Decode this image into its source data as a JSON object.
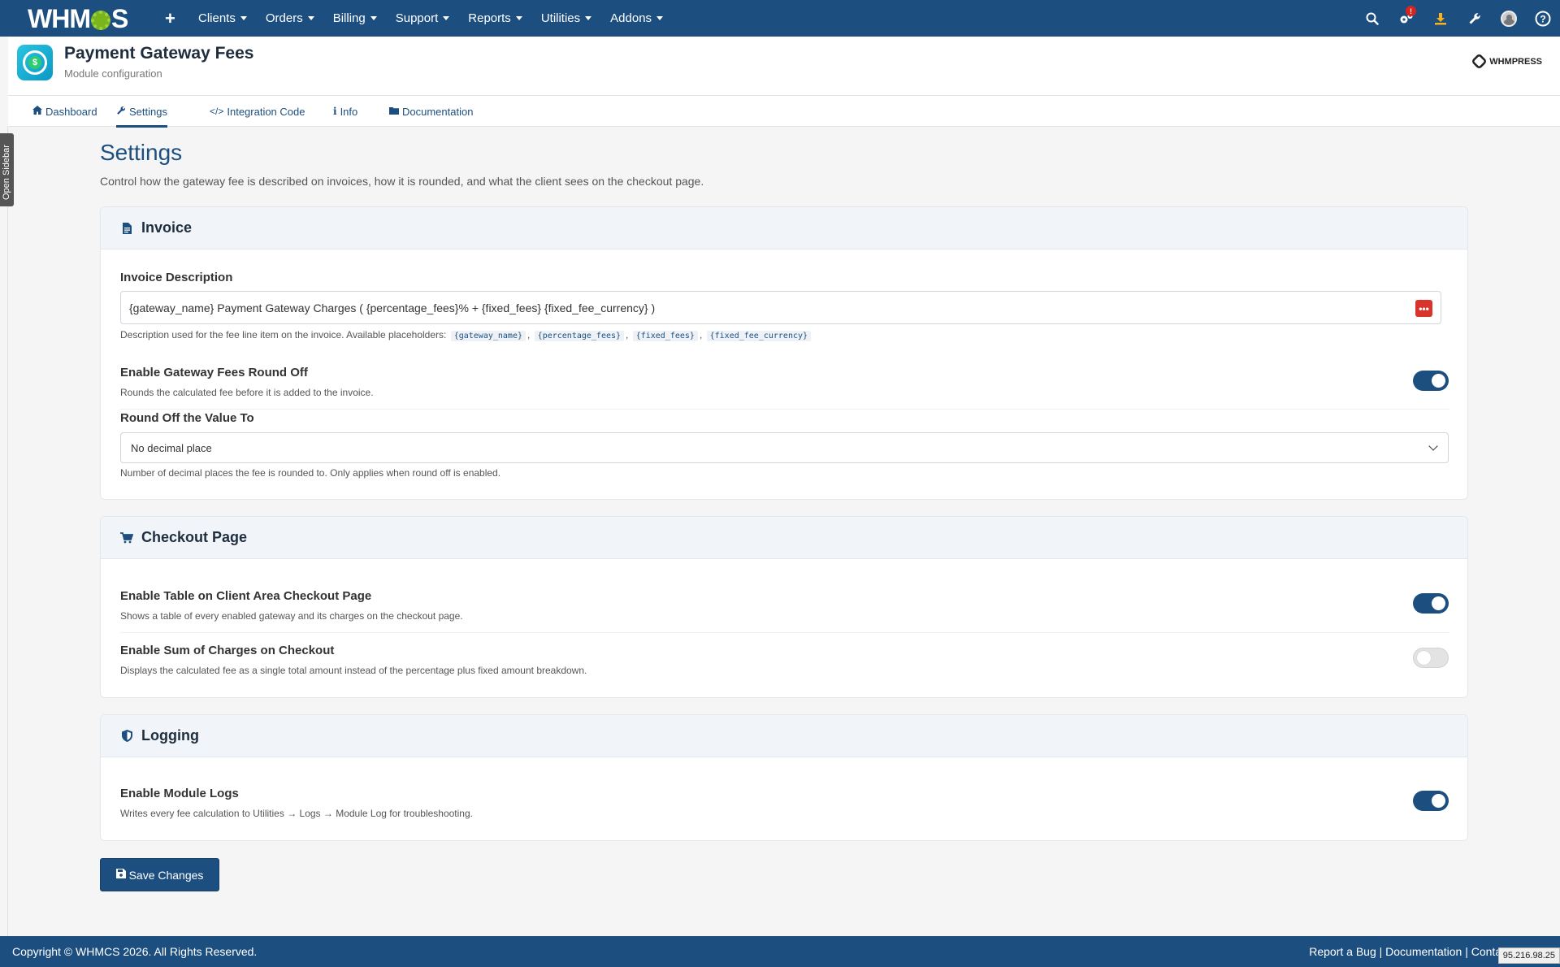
{
  "nav": {
    "logo": "WHMCS",
    "menu": [
      "Clients",
      "Orders",
      "Billing",
      "Support",
      "Reports",
      "Utilities",
      "Addons"
    ],
    "badge_count": "!"
  },
  "header": {
    "title": "Payment Gateway Fees",
    "subtitle": "Module configuration",
    "brand": "WHMPRESS"
  },
  "tabs": [
    {
      "label": "Dashboard",
      "icon": "home-icon"
    },
    {
      "label": "Settings",
      "icon": "wrench-icon"
    },
    {
      "label": "Integration Code",
      "icon": "code-icon"
    },
    {
      "label": "Info",
      "icon": "info-icon"
    },
    {
      "label": "Documentation",
      "icon": "folder-icon"
    }
  ],
  "sidebar_toggle": "Open Sidebar",
  "main": {
    "title": "Settings",
    "description": "Control how the gateway fee is described on invoices, how it is rounded, and what the client sees on the checkout page."
  },
  "invoice": {
    "heading": "Invoice",
    "description_label": "Invoice Description",
    "description_value": "{gateway_name} Payment Gateway Charges ( {percentage_fees}% + {fixed_fees} {fixed_fee_currency} )",
    "description_help": "Description used for the fee line item on the invoice. Available placeholders:",
    "placeholders": [
      "{gateway_name}",
      "{percentage_fees}",
      "{fixed_fees}",
      "{fixed_fee_currency}"
    ],
    "roundoff_label": "Enable Gateway Fees Round Off",
    "roundoff_help": "Rounds the calculated fee before it is added to the invoice.",
    "roundoff_on": true,
    "round_to_label": "Round Off the Value To",
    "round_to_value": "No decimal place",
    "round_to_help": "Number of decimal places the fee is rounded to. Only applies when round off is enabled."
  },
  "checkout": {
    "heading": "Checkout Page",
    "table_label": "Enable Table on Client Area Checkout Page",
    "table_help": "Shows a table of every enabled gateway and its charges on the checkout page.",
    "table_on": true,
    "sum_label": "Enable Sum of Charges on Checkout",
    "sum_help": "Displays the calculated fee as a single total amount instead of the percentage plus fixed amount breakdown.",
    "sum_on": false
  },
  "logging": {
    "heading": "Logging",
    "logs_label": "Enable Module Logs",
    "logs_help": "Writes every fee calculation to Utilities → Logs → Module Log for troubleshooting.",
    "logs_on": true
  },
  "save_label": "Save Changes",
  "footer": {
    "copyright": "Copyright © WHMCS 2026. All Rights Reserved.",
    "links": "Report a Bug | Documentation | Contact Us",
    "ip": "95.216.98.25"
  },
  "colors": {
    "primary": "#1c4f80",
    "toggle_off": "#e3e3e3",
    "danger": "#d9342b"
  }
}
